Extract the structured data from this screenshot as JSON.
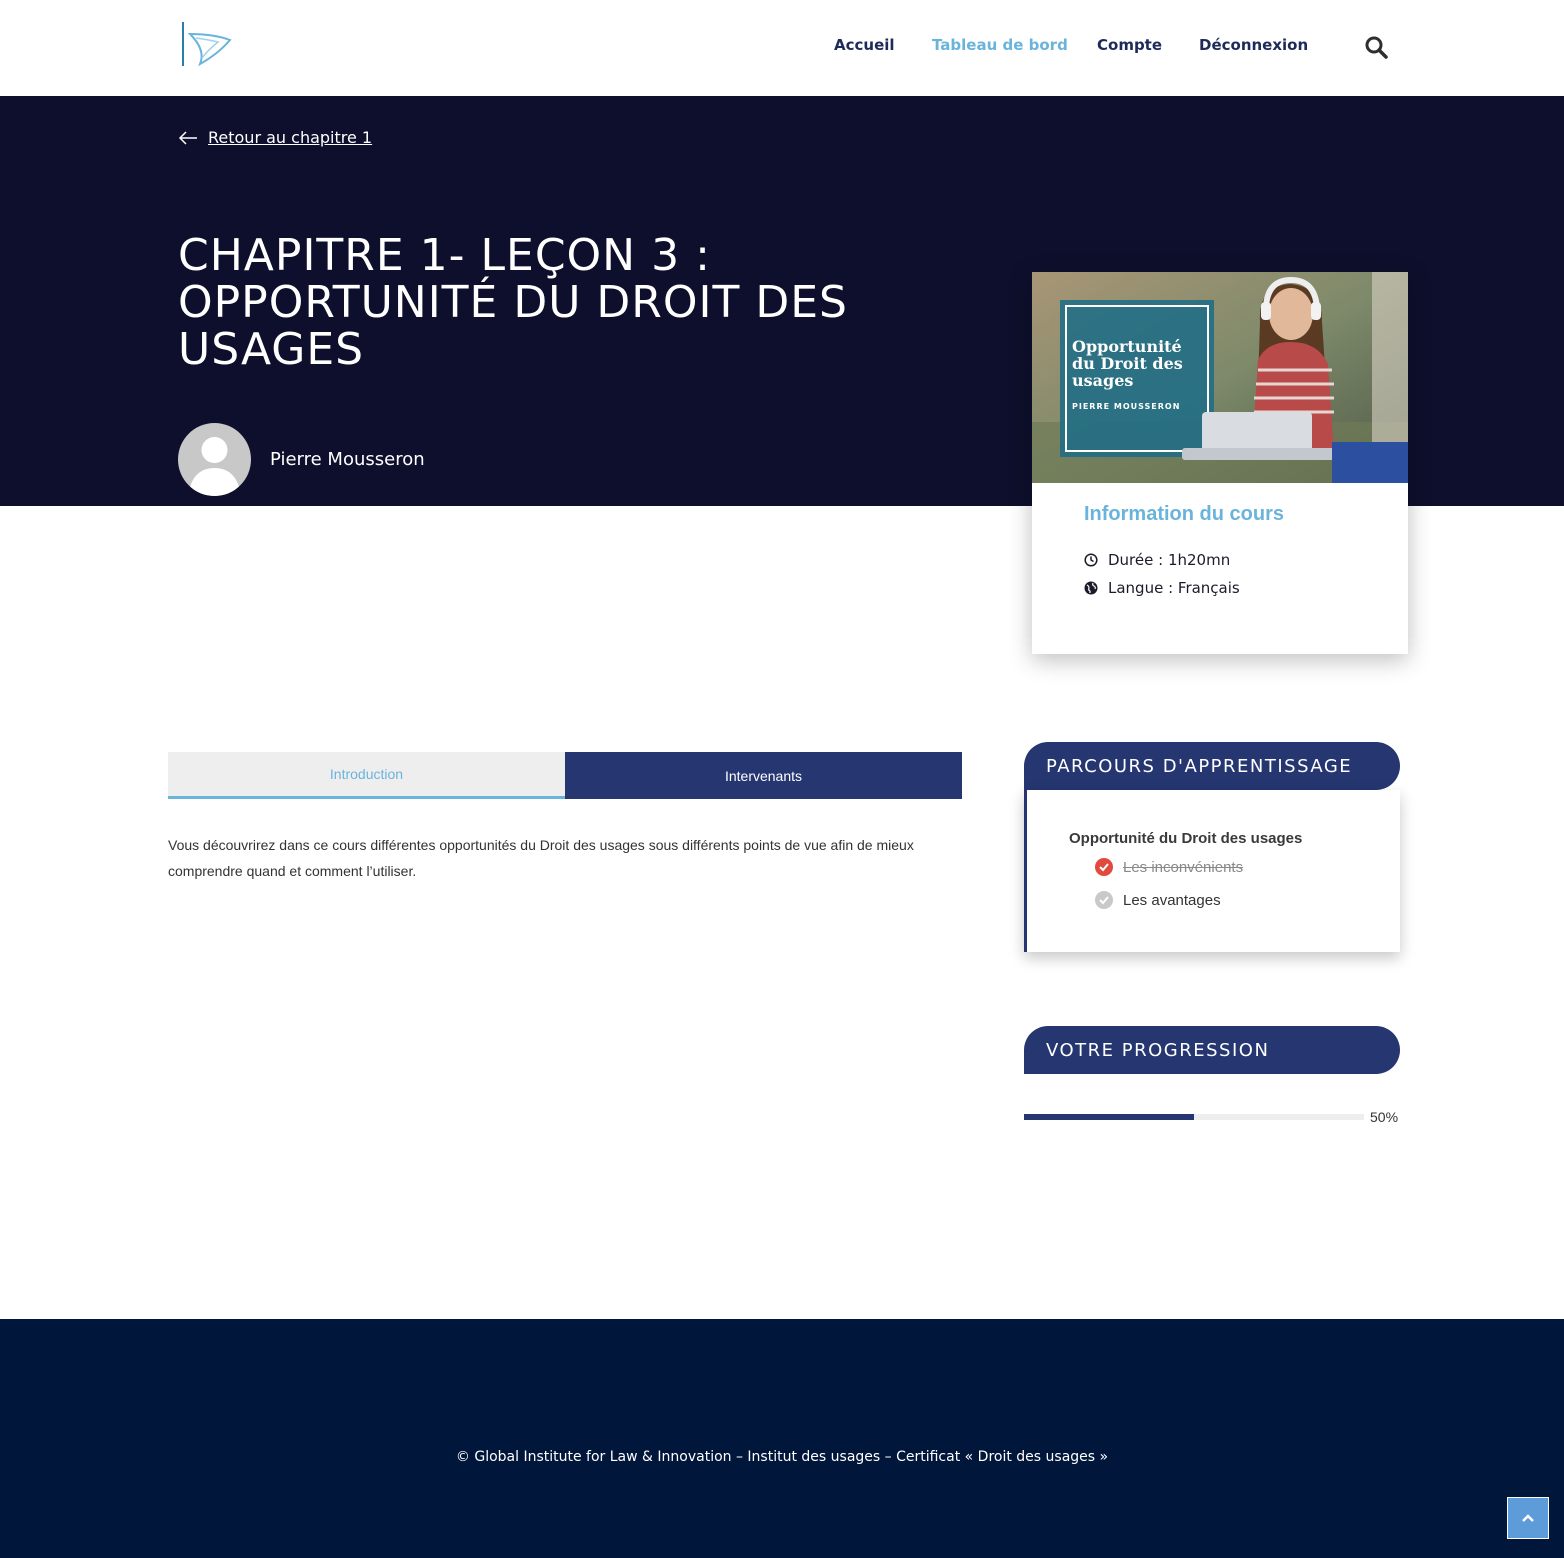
{
  "header": {
    "logo_alt": "Institut des usages",
    "nav": [
      {
        "label": "Accueil",
        "active": false
      },
      {
        "label": "Tableau de bord",
        "active": true
      },
      {
        "label": "Compte",
        "active": false
      },
      {
        "label": "Déconnexion",
        "active": false
      }
    ],
    "search_icon": "search-icon"
  },
  "hero": {
    "back_link": "Retour au chapitre 1",
    "title": "CHAPITRE 1- LEÇON 3 : OPPORTUNITÉ DU DROIT DES USAGES",
    "author": "Pierre Mousseron"
  },
  "course_card": {
    "image_title": "Opportunité du Droit des usages",
    "image_author": "PIERRE MOUSSERON",
    "info_title": "Information du cours",
    "duration": "Durée : 1h20mn",
    "language": "Langue : Français"
  },
  "tabs": [
    {
      "label": "Introduction",
      "active": true
    },
    {
      "label": "Intervenants",
      "active": false
    }
  ],
  "intro_text": "Vous découvrirez dans ce cours différentes opportunités du Droit des usages sous différents points de vue afin de mieux comprendre quand et comment l’utiliser.",
  "parcours": {
    "title": "PARCOURS D'APPRENTISSAGE",
    "course": "Opportunité du Droit des usages",
    "lessons": [
      {
        "label": "Les inconvénients",
        "completed": true
      },
      {
        "label": "Les avantages",
        "completed": false
      }
    ]
  },
  "progression": {
    "title": "VOTRE PROGRESSION",
    "percent": 50,
    "percent_label": "50%"
  },
  "footer": {
    "text": "© Global Institute for Law & Innovation – Institut des usages – Certificat « Droit des usages »"
  },
  "colors": {
    "navy": "#0e0f2c",
    "accent": "#6ab4dc",
    "primary": "#253671",
    "footer": "#00163a",
    "check_done": "#e04a3f",
    "check_pending": "#c9c9c9"
  }
}
